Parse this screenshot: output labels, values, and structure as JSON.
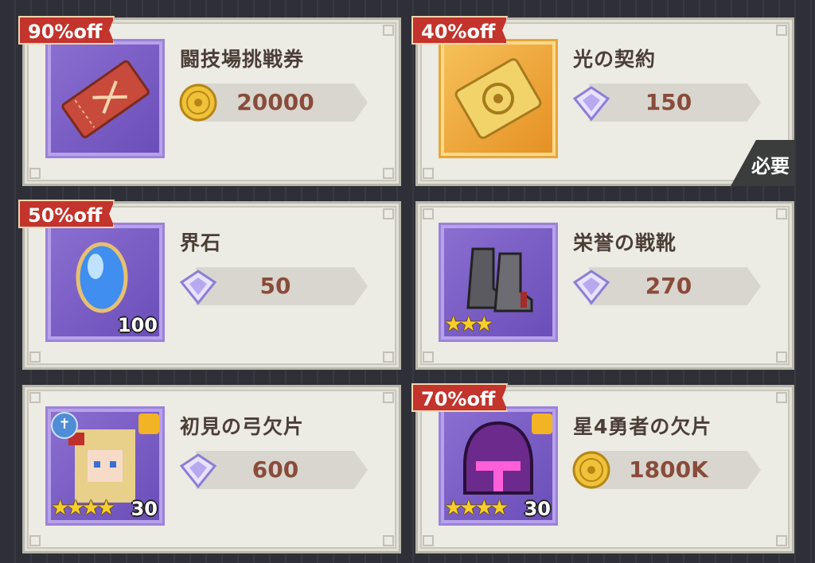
{
  "items": [
    {
      "name": "闘技場挑戦券",
      "price": "20000",
      "currency": "gold-coin",
      "discount": "90%off",
      "frame": "purple",
      "icon": "arena-ticket-icon",
      "qty": "",
      "stars": "",
      "required": ""
    },
    {
      "name": "光の契約",
      "price": "150",
      "currency": "diamond",
      "discount": "40%off",
      "frame": "gold",
      "icon": "light-contract-book-icon",
      "qty": "",
      "stars": "",
      "required": "必要"
    },
    {
      "name": "界石",
      "price": "50",
      "currency": "diamond",
      "discount": "50%off",
      "frame": "purple",
      "icon": "boundary-stone-crystal-icon",
      "qty": "100",
      "stars": "",
      "required": ""
    },
    {
      "name": "栄誉の戦靴",
      "price": "270",
      "currency": "diamond",
      "discount": "",
      "frame": "purple",
      "icon": "boots-of-honor-icon",
      "qty": "",
      "stars": "★★★",
      "required": ""
    },
    {
      "name": "初見の弓欠片",
      "price": "600",
      "currency": "diamond",
      "discount": "",
      "frame": "purple",
      "icon": "archer-hero-portrait-icon",
      "qty": "30",
      "stars": "★★★★",
      "required": ""
    },
    {
      "name": "星4勇者の欠片",
      "price": "1800K",
      "currency": "gold-coin",
      "discount": "70%off",
      "frame": "purple",
      "icon": "mystery-helmet-icon",
      "qty": "30",
      "stars": "★★★★",
      "required": ""
    }
  ],
  "colors": {
    "badge": "#c2342c",
    "price_text": "#8a4b3a",
    "name_text": "#4b3e36"
  }
}
